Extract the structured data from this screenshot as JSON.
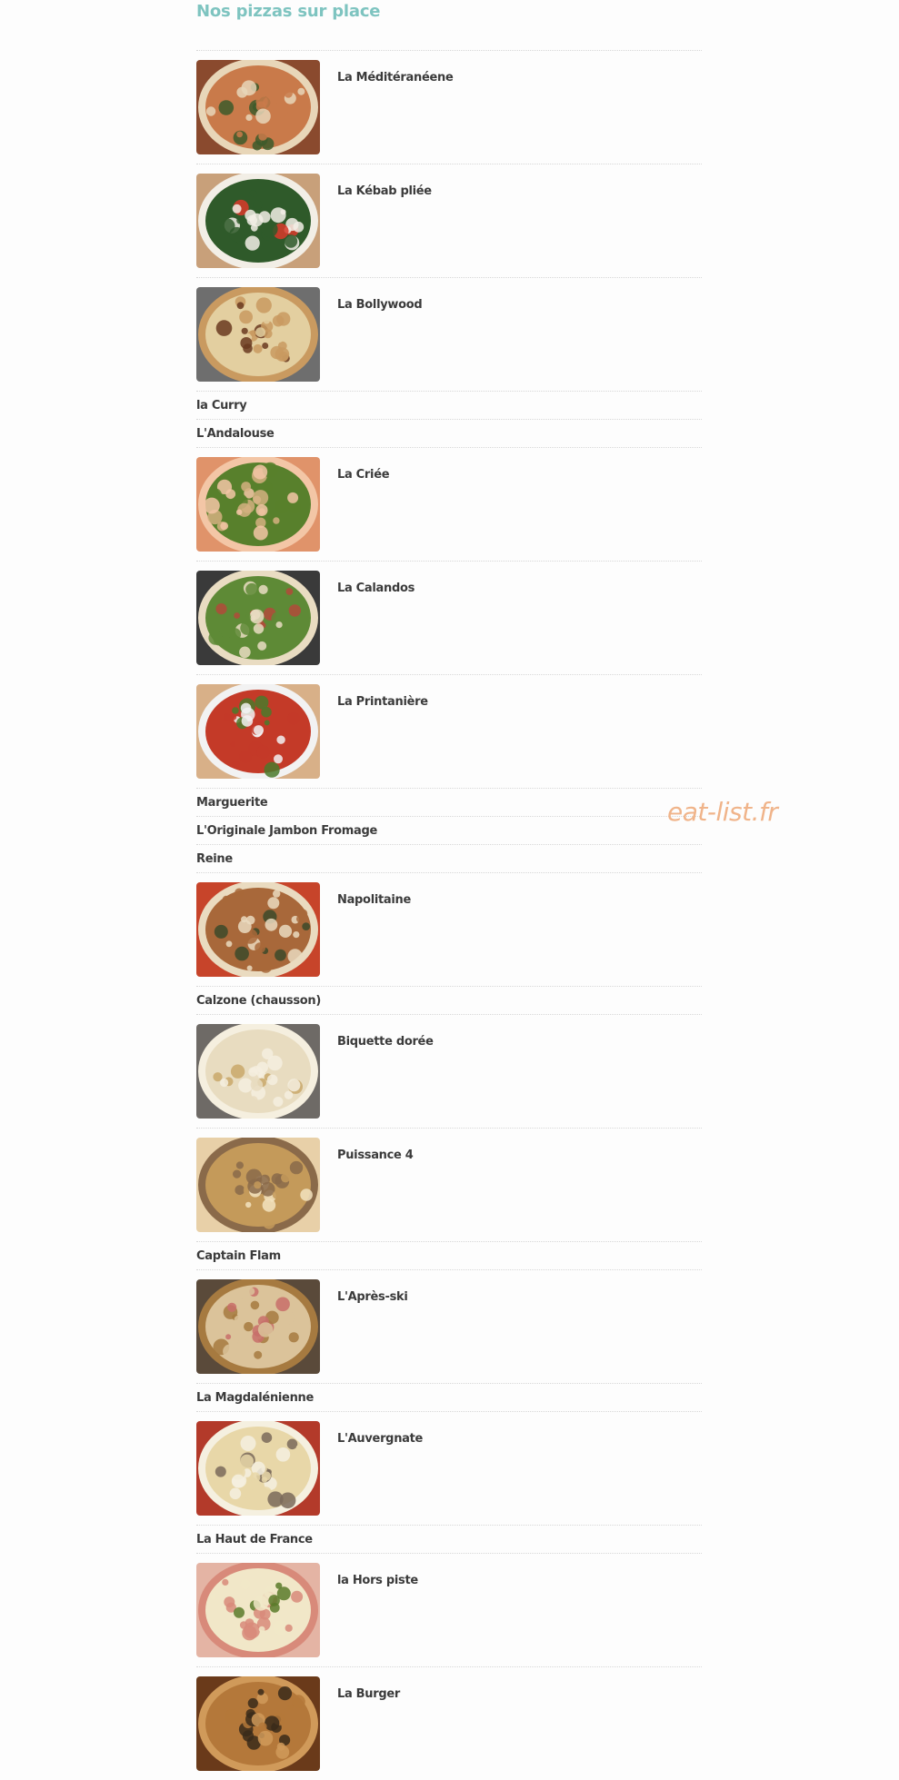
{
  "title": "Nos pizzas sur place",
  "watermark": "eat-list.fr",
  "items": [
    {
      "name": "La Méditéranéene",
      "photo": true,
      "colors": [
        "#8a4a2e",
        "#c97a4a",
        "#3d5a2a",
        "#e8d6b8"
      ]
    },
    {
      "name": "La Kébab pliée",
      "photo": true,
      "colors": [
        "#c8a07a",
        "#2f5a2a",
        "#d93a2a",
        "#f2eee6"
      ]
    },
    {
      "name": "La Bollywood",
      "photo": true,
      "colors": [
        "#6e6e6e",
        "#e3cfa0",
        "#6a3a20",
        "#c99a60"
      ]
    },
    {
      "name": "la Curry",
      "photo": false
    },
    {
      "name": "L'Andalouse",
      "photo": false
    },
    {
      "name": "La Criée",
      "photo": true,
      "colors": [
        "#e0936a",
        "#58802c",
        "#d4b080",
        "#f3c6a6"
      ]
    },
    {
      "name": "La Calandos",
      "photo": true,
      "colors": [
        "#3a3a3a",
        "#5e8a36",
        "#b14a3a",
        "#e9dcc2"
      ]
    },
    {
      "name": "La Printanière",
      "photo": true,
      "colors": [
        "#d8b088",
        "#c43a28",
        "#4b7a2a",
        "#f2f2f2"
      ]
    },
    {
      "name": "Marguerite",
      "photo": false
    },
    {
      "name": "L'Originale Jambon Fromage",
      "photo": false
    },
    {
      "name": "Reine",
      "photo": false
    },
    {
      "name": "Napolitaine",
      "photo": true,
      "colors": [
        "#c7442a",
        "#a8683a",
        "#3c4a2a",
        "#eadbc0"
      ]
    },
    {
      "name": "Calzone (chausson)",
      "photo": false
    },
    {
      "name": "Biquette dorée",
      "photo": true,
      "colors": [
        "#6e6a66",
        "#e8dcc0",
        "#c9a86a",
        "#f5efdf"
      ]
    },
    {
      "name": "Puissance 4",
      "photo": true,
      "colors": [
        "#e8d0a8",
        "#c49a5a",
        "#f3e3c0",
        "#8a6a4a"
      ]
    },
    {
      "name": "Captain Flam",
      "photo": false
    },
    {
      "name": "L'Après-ski",
      "photo": true,
      "colors": [
        "#5a4a3a",
        "#dbc39a",
        "#c86e6a",
        "#a67a40"
      ]
    },
    {
      "name": "La Magdalénienne",
      "photo": false
    },
    {
      "name": "L'Auvergnate",
      "photo": true,
      "colors": [
        "#b33a2a",
        "#e8d7a8",
        "#7a6a5a",
        "#f5f0e0"
      ]
    },
    {
      "name": "La Haut de France",
      "photo": false
    },
    {
      "name": "la Hors piste",
      "photo": true,
      "colors": [
        "#e4b4a4",
        "#f1e7c8",
        "#5a7a2a",
        "#d88a7a"
      ]
    },
    {
      "name": "La Burger",
      "photo": true,
      "colors": [
        "#6a3a1a",
        "#b4783a",
        "#3a2a1a",
        "#d09a5a"
      ]
    }
  ]
}
